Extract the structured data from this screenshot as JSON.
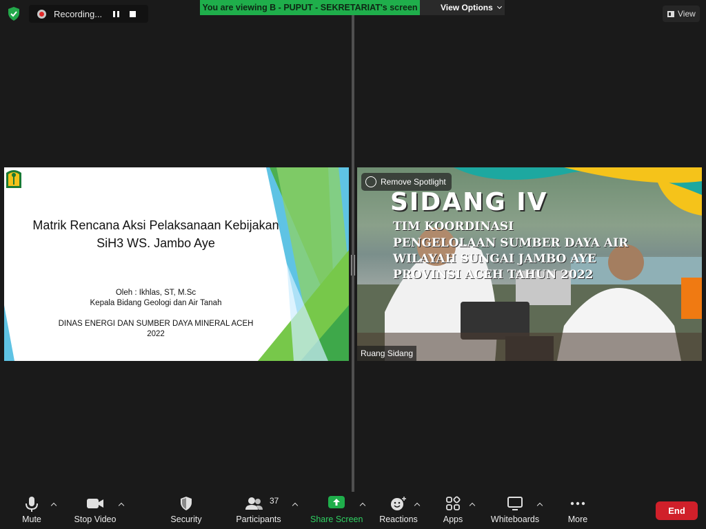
{
  "recording": {
    "label": "Recording..."
  },
  "banner": {
    "viewing": "You are viewing B  -  PUPUT  -  SEKRETARIAT's screen",
    "view_options": "View Options"
  },
  "view_button": {
    "label": "View"
  },
  "shared_slide": {
    "title_line1": "Matrik Rencana Aksi Pelaksanaan Kebijakan",
    "title_line2": "SiH3 WS. Jambo Aye",
    "author": "Oleh : Ikhlas, ST, M.Sc",
    "position": "Kepala Bidang Geologi dan Air Tanah",
    "agency": "DINAS ENERGI DAN SUMBER DAYA MINERAL ACEH",
    "year": "2022"
  },
  "spotlight_video": {
    "remove_spotlight": "Remove Spotlight",
    "title": "SIDANG IV",
    "line1": "TIM KOORDINASI",
    "line2": "PENGELOLAAN SUMBER DAYA AIR",
    "line3": "WILAYAH SUNGAI JAMBO AYE",
    "line4": "PROVINSI ACEH TAHUN 2022",
    "participant_name": "Ruang Sidang"
  },
  "toolbar": {
    "mute": "Mute",
    "stop_video": "Stop Video",
    "security": "Security",
    "participants": "Participants",
    "participants_count": "37",
    "share_screen": "Share Screen",
    "reactions": "Reactions",
    "apps": "Apps",
    "whiteboards": "Whiteboards",
    "more": "More",
    "end": "End"
  },
  "colors": {
    "share_green": "#1fae4b",
    "end_red": "#d0202a",
    "banner_green": "#1fae4b"
  }
}
